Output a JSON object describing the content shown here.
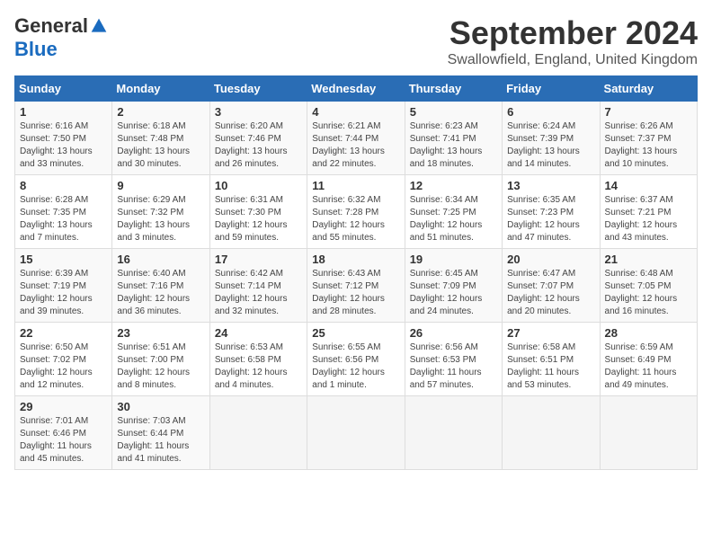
{
  "header": {
    "logo_general": "General",
    "logo_blue": "Blue",
    "month_title": "September 2024",
    "location": "Swallowfield, England, United Kingdom"
  },
  "weekdays": [
    "Sunday",
    "Monday",
    "Tuesday",
    "Wednesday",
    "Thursday",
    "Friday",
    "Saturday"
  ],
  "weeks": [
    [
      {
        "day": 1,
        "info": "Sunrise: 6:16 AM\nSunset: 7:50 PM\nDaylight: 13 hours and 33 minutes."
      },
      {
        "day": 2,
        "info": "Sunrise: 6:18 AM\nSunset: 7:48 PM\nDaylight: 13 hours and 30 minutes."
      },
      {
        "day": 3,
        "info": "Sunrise: 6:20 AM\nSunset: 7:46 PM\nDaylight: 13 hours and 26 minutes."
      },
      {
        "day": 4,
        "info": "Sunrise: 6:21 AM\nSunset: 7:44 PM\nDaylight: 13 hours and 22 minutes."
      },
      {
        "day": 5,
        "info": "Sunrise: 6:23 AM\nSunset: 7:41 PM\nDaylight: 13 hours and 18 minutes."
      },
      {
        "day": 6,
        "info": "Sunrise: 6:24 AM\nSunset: 7:39 PM\nDaylight: 13 hours and 14 minutes."
      },
      {
        "day": 7,
        "info": "Sunrise: 6:26 AM\nSunset: 7:37 PM\nDaylight: 13 hours and 10 minutes."
      }
    ],
    [
      {
        "day": 8,
        "info": "Sunrise: 6:28 AM\nSunset: 7:35 PM\nDaylight: 13 hours and 7 minutes."
      },
      {
        "day": 9,
        "info": "Sunrise: 6:29 AM\nSunset: 7:32 PM\nDaylight: 13 hours and 3 minutes."
      },
      {
        "day": 10,
        "info": "Sunrise: 6:31 AM\nSunset: 7:30 PM\nDaylight: 12 hours and 59 minutes."
      },
      {
        "day": 11,
        "info": "Sunrise: 6:32 AM\nSunset: 7:28 PM\nDaylight: 12 hours and 55 minutes."
      },
      {
        "day": 12,
        "info": "Sunrise: 6:34 AM\nSunset: 7:25 PM\nDaylight: 12 hours and 51 minutes."
      },
      {
        "day": 13,
        "info": "Sunrise: 6:35 AM\nSunset: 7:23 PM\nDaylight: 12 hours and 47 minutes."
      },
      {
        "day": 14,
        "info": "Sunrise: 6:37 AM\nSunset: 7:21 PM\nDaylight: 12 hours and 43 minutes."
      }
    ],
    [
      {
        "day": 15,
        "info": "Sunrise: 6:39 AM\nSunset: 7:19 PM\nDaylight: 12 hours and 39 minutes."
      },
      {
        "day": 16,
        "info": "Sunrise: 6:40 AM\nSunset: 7:16 PM\nDaylight: 12 hours and 36 minutes."
      },
      {
        "day": 17,
        "info": "Sunrise: 6:42 AM\nSunset: 7:14 PM\nDaylight: 12 hours and 32 minutes."
      },
      {
        "day": 18,
        "info": "Sunrise: 6:43 AM\nSunset: 7:12 PM\nDaylight: 12 hours and 28 minutes."
      },
      {
        "day": 19,
        "info": "Sunrise: 6:45 AM\nSunset: 7:09 PM\nDaylight: 12 hours and 24 minutes."
      },
      {
        "day": 20,
        "info": "Sunrise: 6:47 AM\nSunset: 7:07 PM\nDaylight: 12 hours and 20 minutes."
      },
      {
        "day": 21,
        "info": "Sunrise: 6:48 AM\nSunset: 7:05 PM\nDaylight: 12 hours and 16 minutes."
      }
    ],
    [
      {
        "day": 22,
        "info": "Sunrise: 6:50 AM\nSunset: 7:02 PM\nDaylight: 12 hours and 12 minutes."
      },
      {
        "day": 23,
        "info": "Sunrise: 6:51 AM\nSunset: 7:00 PM\nDaylight: 12 hours and 8 minutes."
      },
      {
        "day": 24,
        "info": "Sunrise: 6:53 AM\nSunset: 6:58 PM\nDaylight: 12 hours and 4 minutes."
      },
      {
        "day": 25,
        "info": "Sunrise: 6:55 AM\nSunset: 6:56 PM\nDaylight: 12 hours and 1 minute."
      },
      {
        "day": 26,
        "info": "Sunrise: 6:56 AM\nSunset: 6:53 PM\nDaylight: 11 hours and 57 minutes."
      },
      {
        "day": 27,
        "info": "Sunrise: 6:58 AM\nSunset: 6:51 PM\nDaylight: 11 hours and 53 minutes."
      },
      {
        "day": 28,
        "info": "Sunrise: 6:59 AM\nSunset: 6:49 PM\nDaylight: 11 hours and 49 minutes."
      }
    ],
    [
      {
        "day": 29,
        "info": "Sunrise: 7:01 AM\nSunset: 6:46 PM\nDaylight: 11 hours and 45 minutes."
      },
      {
        "day": 30,
        "info": "Sunrise: 7:03 AM\nSunset: 6:44 PM\nDaylight: 11 hours and 41 minutes."
      },
      {
        "day": null,
        "info": ""
      },
      {
        "day": null,
        "info": ""
      },
      {
        "day": null,
        "info": ""
      },
      {
        "day": null,
        "info": ""
      },
      {
        "day": null,
        "info": ""
      }
    ]
  ]
}
